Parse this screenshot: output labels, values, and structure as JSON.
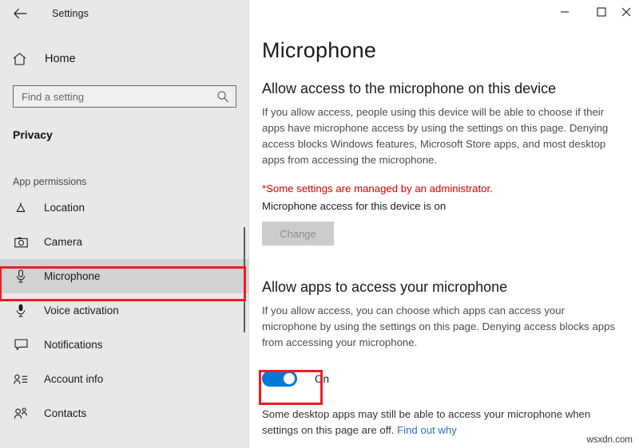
{
  "window": {
    "title": "Settings",
    "back_icon": "back-arrow-icon",
    "controls": {
      "minimize": "minimize-icon",
      "maximize": "maximize-icon",
      "close": "close-icon"
    }
  },
  "sidebar": {
    "home": {
      "label": "Home",
      "icon": "home-icon"
    },
    "search": {
      "placeholder": "Find a setting",
      "value": "",
      "icon": "search-icon"
    },
    "section_title": "Privacy",
    "group_label": "App permissions",
    "items": [
      {
        "label": "Location",
        "icon": "location-icon",
        "selected": false
      },
      {
        "label": "Camera",
        "icon": "camera-icon",
        "selected": false
      },
      {
        "label": "Microphone",
        "icon": "microphone-icon",
        "selected": true
      },
      {
        "label": "Voice activation",
        "icon": "voice-activation-icon",
        "selected": false
      },
      {
        "label": "Notifications",
        "icon": "notifications-icon",
        "selected": false
      },
      {
        "label": "Account info",
        "icon": "account-info-icon",
        "selected": false
      },
      {
        "label": "Contacts",
        "icon": "contacts-icon",
        "selected": false
      }
    ]
  },
  "main": {
    "page_title": "Microphone",
    "device_section": {
      "heading": "Allow access to the microphone on this device",
      "description": "If you allow access, people using this device will be able to choose if their apps have microphone access by using the settings on this page. Denying access blocks Windows features, Microsoft Store apps, and most desktop apps from accessing the microphone.",
      "admin_note": "*Some settings are managed by an administrator.",
      "status": "Microphone access for this device is on",
      "change_button": "Change"
    },
    "apps_section": {
      "heading": "Allow apps to access your microphone",
      "description": "If you allow access, you can choose which apps can access your microphone by using the settings on this page. Denying access blocks apps from accessing your microphone.",
      "toggle_state": "On",
      "footer_text": "Some desktop apps may still be able to access your microphone when settings on this page are off. ",
      "footer_link": "Find out why"
    }
  },
  "watermark": "wsxdn.com",
  "colors": {
    "accent": "#0078d7",
    "annotation": "#ee1c24",
    "warning": "#d30000",
    "link": "#2a6fc9",
    "sidebar_bg": "#e8e8e8",
    "selected_bg": "#d2d2d2"
  }
}
